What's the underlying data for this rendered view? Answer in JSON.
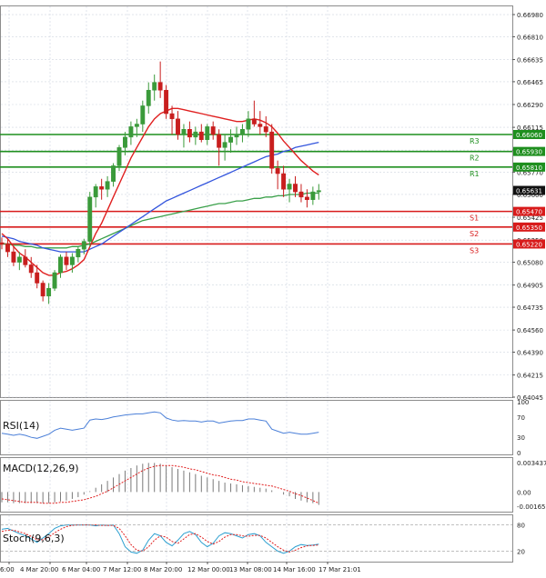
{
  "colors": {
    "up_candle": "#3a9a3a",
    "down_candle": "#c81e1e",
    "ma_fast": "#e02020",
    "ma_mid": "#3355dd",
    "ma_slow": "#3aa04a",
    "resistance": "#1f8f1f",
    "support": "#d81b1b",
    "rsi_line": "#4a7fd8",
    "macd_hist": "#7a7a7a",
    "macd_signal": "#e02020",
    "stoch_main": "#2b9fd0",
    "stoch_signal": "#e02020",
    "grid": "#cfd6e0"
  },
  "price_axis": {
    "ticks": [
      "0.66980",
      "0.66810",
      "0.66635",
      "0.66465",
      "0.66290",
      "0.66115",
      "0.65940",
      "0.65770",
      "0.65600",
      "0.65425",
      "0.65250",
      "0.65080",
      "0.64905",
      "0.64735",
      "0.64560",
      "0.64390",
      "0.64215",
      "0.64045"
    ]
  },
  "current_price": "0.65631",
  "levels": {
    "resistance": [
      {
        "name": "R3",
        "price": "0.66060"
      },
      {
        "name": "R2",
        "price": "0.65930"
      },
      {
        "name": "R1",
        "price": "0.65810"
      }
    ],
    "support": [
      {
        "name": "S1",
        "price": "0.65470"
      },
      {
        "name": "S2",
        "price": "0.65350"
      },
      {
        "name": "S3",
        "price": "0.65220"
      }
    ]
  },
  "time_axis": [
    "6:00",
    "4 Mar 20:00",
    "6 Mar 04:00",
    "7 Mar 12:00",
    "8 Mar 20:00",
    "12 Mar 00:00",
    "13 Mar 08:00",
    "14 Mar 16:00",
    "17 Mar 21:01"
  ],
  "indicators": {
    "rsi": {
      "label": "RSI(14)",
      "ticks": [
        "100",
        "70",
        "30",
        "0"
      ]
    },
    "macd": {
      "label": "MACD(12,26,9)",
      "ticks": [
        "0.003437",
        "0.00",
        "-0.001655"
      ]
    },
    "stoch": {
      "label": "Stoch(9,6,3)",
      "ticks": [
        "80",
        "20"
      ]
    }
  },
  "chart_data": {
    "type": "candlestick",
    "ylim": [
      0.64045,
      0.6705
    ],
    "candles": [
      [
        0.6523,
        0.6527,
        0.6518,
        0.6522
      ],
      [
        0.6522,
        0.6526,
        0.6512,
        0.6516
      ],
      [
        0.6516,
        0.652,
        0.6505,
        0.6508
      ],
      [
        0.6508,
        0.6516,
        0.6502,
        0.6512
      ],
      [
        0.6512,
        0.6518,
        0.6504,
        0.6506
      ],
      [
        0.6506,
        0.6512,
        0.6496,
        0.65
      ],
      [
        0.65,
        0.6506,
        0.6488,
        0.6492
      ],
      [
        0.6492,
        0.6494,
        0.6478,
        0.6482
      ],
      [
        0.6482,
        0.6492,
        0.6476,
        0.6488
      ],
      [
        0.6488,
        0.6502,
        0.6486,
        0.65
      ],
      [
        0.65,
        0.6514,
        0.6496,
        0.6512
      ],
      [
        0.6512,
        0.6516,
        0.6502,
        0.6506
      ],
      [
        0.6506,
        0.6515,
        0.65,
        0.6512
      ],
      [
        0.6512,
        0.652,
        0.6508,
        0.6518
      ],
      [
        0.6518,
        0.6526,
        0.6514,
        0.6524
      ],
      [
        0.6524,
        0.6562,
        0.652,
        0.6558
      ],
      [
        0.6558,
        0.6568,
        0.655,
        0.6566
      ],
      [
        0.6566,
        0.6572,
        0.6556,
        0.6564
      ],
      [
        0.6564,
        0.6574,
        0.6558,
        0.657
      ],
      [
        0.657,
        0.6584,
        0.6566,
        0.6582
      ],
      [
        0.6582,
        0.6598,
        0.6578,
        0.6596
      ],
      [
        0.6596,
        0.6608,
        0.659,
        0.6604
      ],
      [
        0.6604,
        0.6616,
        0.6598,
        0.6612
      ],
      [
        0.6612,
        0.6618,
        0.6604,
        0.6614
      ],
      [
        0.6614,
        0.6632,
        0.6608,
        0.6628
      ],
      [
        0.6628,
        0.6646,
        0.6622,
        0.664
      ],
      [
        0.664,
        0.6652,
        0.6632,
        0.6646
      ],
      [
        0.6646,
        0.6662,
        0.6634,
        0.664
      ],
      [
        0.664,
        0.6644,
        0.6618,
        0.6622
      ],
      [
        0.6622,
        0.6628,
        0.6606,
        0.6618
      ],
      [
        0.6618,
        0.6624,
        0.6602,
        0.6606
      ],
      [
        0.6606,
        0.6614,
        0.6596,
        0.661
      ],
      [
        0.661,
        0.6616,
        0.66,
        0.6604
      ],
      [
        0.6604,
        0.6612,
        0.6598,
        0.6608
      ],
      [
        0.6608,
        0.6614,
        0.66,
        0.6602
      ],
      [
        0.6602,
        0.6614,
        0.6598,
        0.6612
      ],
      [
        0.6612,
        0.6616,
        0.6602,
        0.6606
      ],
      [
        0.6606,
        0.661,
        0.6582,
        0.6596
      ],
      [
        0.6596,
        0.6606,
        0.6586,
        0.66
      ],
      [
        0.66,
        0.661,
        0.6592,
        0.6604
      ],
      [
        0.6604,
        0.6612,
        0.6598,
        0.6606
      ],
      [
        0.6606,
        0.6614,
        0.66,
        0.661
      ],
      [
        0.661,
        0.6624,
        0.6604,
        0.6618
      ],
      [
        0.6618,
        0.6632,
        0.6612,
        0.6614
      ],
      [
        0.6614,
        0.6624,
        0.6606,
        0.6612
      ],
      [
        0.6612,
        0.662,
        0.6604,
        0.6608
      ],
      [
        0.6608,
        0.6614,
        0.6576,
        0.658
      ],
      [
        0.658,
        0.6586,
        0.6564,
        0.6576
      ],
      [
        0.6576,
        0.6582,
        0.6558,
        0.6564
      ],
      [
        0.6564,
        0.6572,
        0.6554,
        0.6568
      ],
      [
        0.6568,
        0.6574,
        0.6558,
        0.6562
      ],
      [
        0.6562,
        0.6568,
        0.6554,
        0.6558
      ],
      [
        0.6558,
        0.6564,
        0.655,
        0.6556
      ],
      [
        0.6556,
        0.6566,
        0.6552,
        0.6562
      ],
      [
        0.6562,
        0.6568,
        0.6556,
        0.6563
      ]
    ],
    "ma_fast": [
      0.653,
      0.6526,
      0.652,
      0.6515,
      0.6512,
      0.6508,
      0.6504,
      0.65,
      0.6498,
      0.6498,
      0.65,
      0.6501,
      0.6503,
      0.6506,
      0.651,
      0.652,
      0.653,
      0.6538,
      0.6548,
      0.6558,
      0.6568,
      0.6578,
      0.6588,
      0.6596,
      0.6604,
      0.6612,
      0.6618,
      0.6622,
      0.6624,
      0.6626,
      0.6626,
      0.6625,
      0.6624,
      0.6623,
      0.6622,
      0.6621,
      0.662,
      0.6619,
      0.6618,
      0.6617,
      0.6616,
      0.6616,
      0.6617,
      0.6618,
      0.6617,
      0.6615,
      0.6612,
      0.6607,
      0.6601,
      0.6596,
      0.6591,
      0.6586,
      0.6582,
      0.6578,
      0.6575
    ],
    "ma_mid": [
      0.6528,
      0.6527,
      0.6526,
      0.6524,
      0.6523,
      0.6522,
      0.6521,
      0.6519,
      0.6518,
      0.6517,
      0.6516,
      0.6516,
      0.6516,
      0.6516,
      0.6516,
      0.6518,
      0.652,
      0.6522,
      0.6525,
      0.6528,
      0.6531,
      0.6534,
      0.6537,
      0.654,
      0.6543,
      0.6546,
      0.6549,
      0.6552,
      0.6555,
      0.6557,
      0.6559,
      0.6561,
      0.6563,
      0.6565,
      0.6567,
      0.6569,
      0.6571,
      0.6573,
      0.6575,
      0.6577,
      0.6579,
      0.6581,
      0.6583,
      0.6585,
      0.6587,
      0.6589,
      0.659,
      0.6591,
      0.6593,
      0.6594,
      0.6596,
      0.6597,
      0.6598,
      0.6599,
      0.66
    ],
    "ma_slow": [
      0.6522,
      0.6522,
      0.6521,
      0.6521,
      0.652,
      0.652,
      0.6519,
      0.6519,
      0.6519,
      0.6519,
      0.6519,
      0.6519,
      0.652,
      0.652,
      0.6521,
      0.6522,
      0.6524,
      0.6526,
      0.6528,
      0.653,
      0.6532,
      0.6534,
      0.6536,
      0.6538,
      0.654,
      0.6541,
      0.6542,
      0.6543,
      0.6544,
      0.6545,
      0.6546,
      0.6547,
      0.6548,
      0.6549,
      0.655,
      0.6551,
      0.6552,
      0.6553,
      0.6553,
      0.6554,
      0.6555,
      0.6555,
      0.6556,
      0.6557,
      0.6557,
      0.6558,
      0.6558,
      0.6559,
      0.6559,
      0.656,
      0.656,
      0.656,
      0.6561,
      0.6561,
      0.6561
    ],
    "rsi": [
      38,
      36,
      34,
      36,
      34,
      30,
      28,
      32,
      36,
      44,
      48,
      46,
      44,
      46,
      48,
      64,
      66,
      65,
      67,
      70,
      72,
      74,
      75,
      76,
      76,
      78,
      80,
      78,
      68,
      64,
      62,
      63,
      62,
      62,
      60,
      62,
      62,
      58,
      60,
      62,
      63,
      63,
      66,
      66,
      64,
      62,
      46,
      42,
      38,
      40,
      38,
      36,
      36,
      38,
      40
    ],
    "macd_hist": [
      -0.0012,
      -0.0012,
      -0.0013,
      -0.0013,
      -0.0013,
      -0.0013,
      -0.0013,
      -0.0013,
      -0.0013,
      -0.0012,
      -0.0011,
      -0.001,
      -0.0008,
      -0.0006,
      -0.0003,
      0.0001,
      0.0005,
      0.0009,
      0.0013,
      0.0017,
      0.0021,
      0.0025,
      0.0028,
      0.0031,
      0.0033,
      0.0034,
      0.0034,
      0.0033,
      0.0031,
      0.0029,
      0.0027,
      0.0025,
      0.0023,
      0.0021,
      0.0019,
      0.0017,
      0.0015,
      0.0013,
      0.0011,
      0.001,
      0.0009,
      0.0008,
      0.0007,
      0.0006,
      0.0005,
      0.0004,
      0.0002,
      0.0,
      -0.0003,
      -0.0005,
      -0.0008,
      -0.001,
      -0.0012,
      -0.0013,
      -0.0015
    ],
    "macd_signal": [
      -0.0008,
      -0.0009,
      -0.001,
      -0.0011,
      -0.0012,
      -0.0012,
      -0.0012,
      -0.0013,
      -0.0013,
      -0.0013,
      -0.0012,
      -0.0012,
      -0.0011,
      -0.001,
      -0.0009,
      -0.0007,
      -0.0005,
      -0.0002,
      0.0001,
      0.0005,
      0.0009,
      0.0013,
      0.0017,
      0.0021,
      0.0025,
      0.0028,
      0.003,
      0.0031,
      0.0031,
      0.0031,
      0.003,
      0.0029,
      0.0027,
      0.0026,
      0.0024,
      0.0022,
      0.002,
      0.0019,
      0.0017,
      0.0015,
      0.0014,
      0.0012,
      0.0011,
      0.001,
      0.0009,
      0.0008,
      0.0007,
      0.0005,
      0.0003,
      0.0001,
      -0.0002,
      -0.0004,
      -0.0007,
      -0.001,
      -0.0013
    ],
    "stoch_main": [
      70,
      72,
      66,
      60,
      55,
      48,
      40,
      50,
      60,
      72,
      78,
      80,
      80,
      80,
      80,
      80,
      78,
      80,
      79,
      80,
      60,
      30,
      18,
      15,
      22,
      45,
      60,
      55,
      40,
      32,
      45,
      60,
      65,
      58,
      40,
      30,
      38,
      55,
      62,
      60,
      55,
      50,
      58,
      60,
      55,
      40,
      30,
      20,
      15,
      20,
      30,
      35,
      33,
      34,
      36
    ],
    "stoch_signal": [
      65,
      68,
      68,
      64,
      60,
      54,
      46,
      46,
      52,
      62,
      70,
      76,
      79,
      80,
      80,
      80,
      80,
      79,
      79,
      79,
      72,
      55,
      35,
      22,
      20,
      30,
      45,
      55,
      52,
      42,
      38,
      48,
      58,
      60,
      52,
      42,
      36,
      42,
      52,
      58,
      58,
      55,
      54,
      56,
      56,
      50,
      40,
      30,
      22,
      18,
      22,
      28,
      32,
      33,
      34
    ]
  }
}
